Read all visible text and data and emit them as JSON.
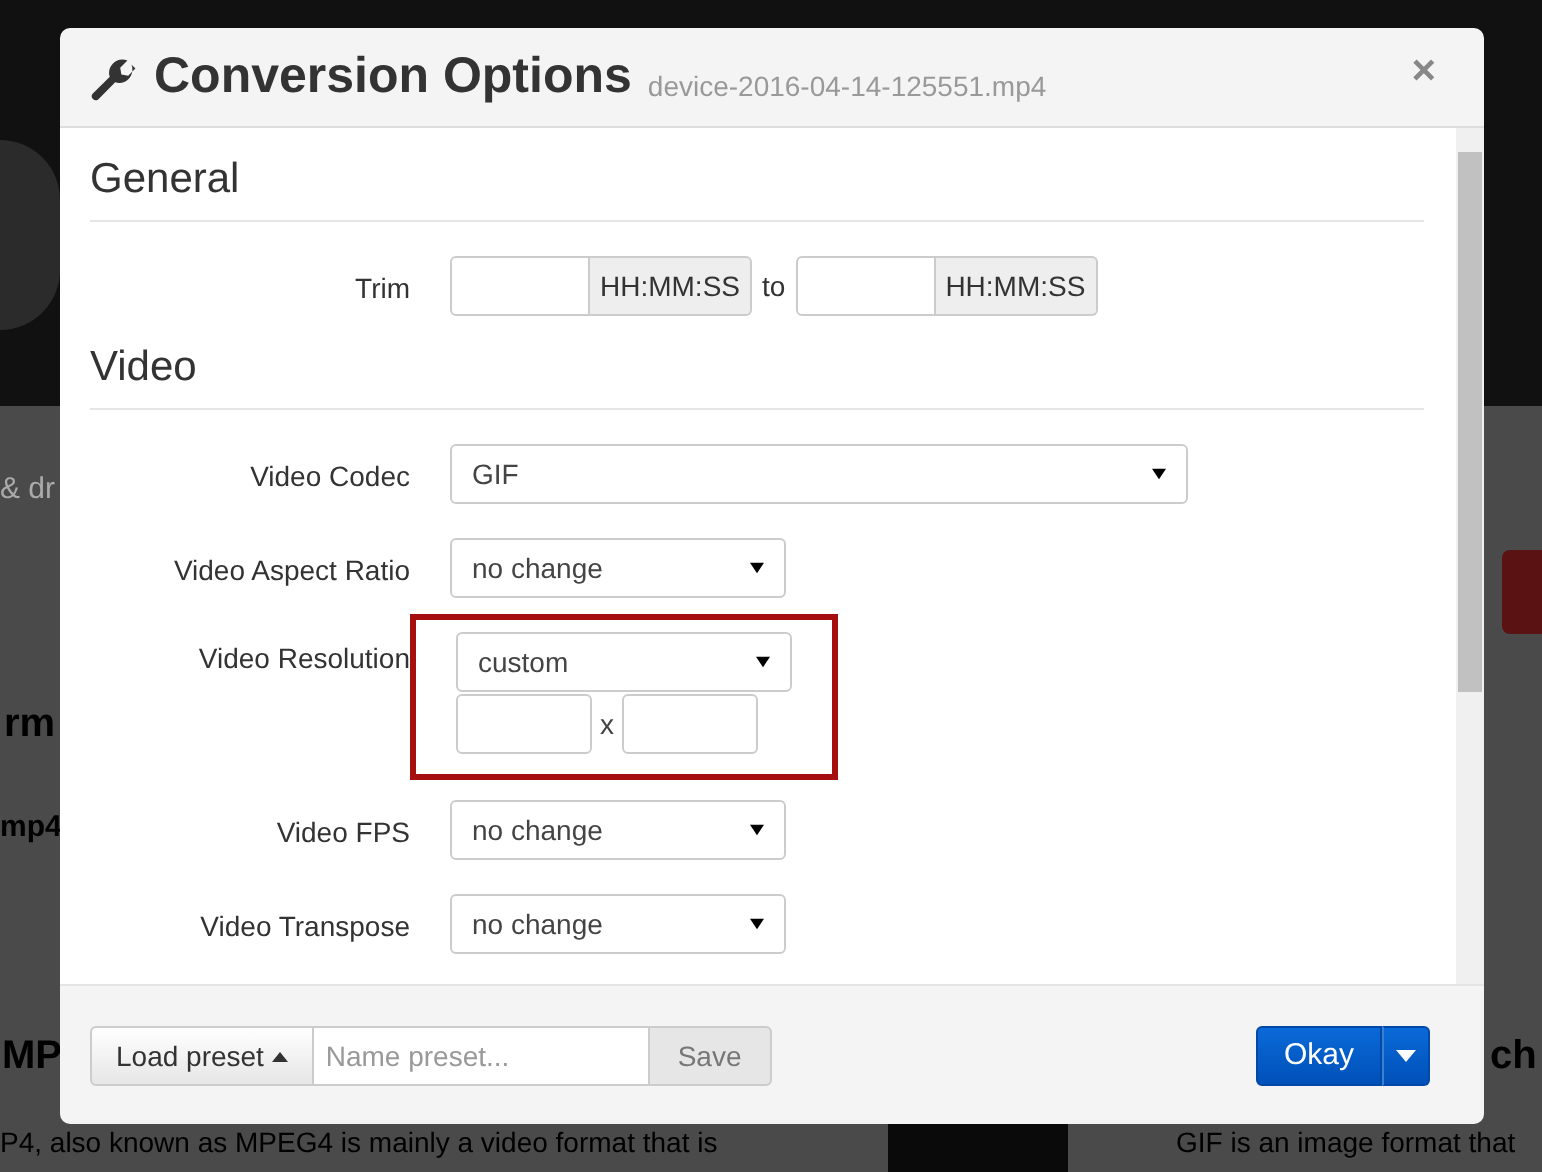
{
  "background": {
    "texts": [
      {
        "kind": "fragment",
        "text": "& dr"
      },
      {
        "kind": "heading",
        "text": "rm"
      },
      {
        "kind": "bold",
        "text": "mp4"
      },
      {
        "kind": "heading",
        "text": "MP"
      },
      {
        "kind": "heading",
        "text": "ch"
      },
      {
        "kind": "paragraph",
        "text": "P4, also known as MPEG4 is mainly a video format that is"
      },
      {
        "kind": "paragraph",
        "text": "GIF is an image format that"
      }
    ]
  },
  "dialog": {
    "title": "Conversion Options",
    "filename": "device-2016-04-14-125551.mp4",
    "close": "×",
    "sections": [
      {
        "heading": "General",
        "rows": [
          {
            "kind": "time_range",
            "label": "Trim",
            "unit_from": "HH:MM:SS",
            "joiner": "to",
            "unit_to": "HH:MM:SS"
          }
        ]
      },
      {
        "heading": "Video",
        "rows": [
          {
            "kind": "select_wide",
            "label": "Video Codec",
            "value": "GIF"
          },
          {
            "kind": "select",
            "label": "Video Aspect Ratio",
            "value": "no change"
          },
          {
            "kind": "resolution",
            "label": "Video Resolution",
            "value": "custom",
            "separator": "x",
            "highlighted": true
          },
          {
            "kind": "select",
            "label": "Video FPS",
            "value": "no change"
          },
          {
            "kind": "select",
            "label": "Video Transpose",
            "value": "no change"
          }
        ]
      }
    ],
    "footer": {
      "load_preset": "Load preset",
      "name_placeholder": "Name preset...",
      "save": "Save",
      "okay": "Okay"
    }
  }
}
